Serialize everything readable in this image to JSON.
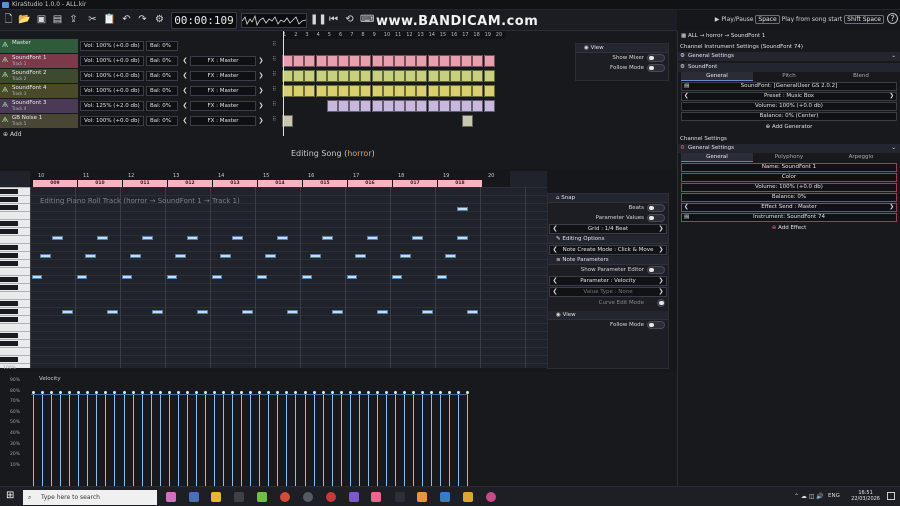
{
  "window": {
    "title": "KiraStudio 1.0.0 - ALL.kir"
  },
  "toolbar": {
    "time": "00:00:109",
    "overlay": "www.BANDICAM.com",
    "hint_play": "Play/Pause",
    "hint_play_key": "Space",
    "hint_start": "Play from song start",
    "hint_start_key": "Shift Space",
    "help": "?"
  },
  "song": {
    "ruler": [
      "1",
      "2",
      "3",
      "4",
      "5",
      "6",
      "7",
      "8",
      "9",
      "10",
      "11",
      "12",
      "13",
      "14",
      "15",
      "16",
      "17",
      "18",
      "19",
      "20"
    ],
    "tracks": [
      {
        "name": "Master",
        "sub": "",
        "vol": "Vol: 100% (+0.0 db)",
        "bal": "Bal: 0%",
        "fx": "",
        "color": "#2e5c3a"
      },
      {
        "name": "SoundFont 1",
        "sub": "Track 1",
        "vol": "Vol: 100% (+0.0 db)",
        "bal": "Bal: 0%",
        "fx": "FX : Master",
        "color": "#7a3a4a"
      },
      {
        "name": "SoundFont 2",
        "sub": "Track 2",
        "vol": "Vol: 100% (+0.0 db)",
        "bal": "Bal: 0%",
        "fx": "FX : Master",
        "color": "#3e4a30"
      },
      {
        "name": "SoundFont 4",
        "sub": "Track 3",
        "vol": "Vol: 100% (+0.0 db)",
        "bal": "Bal: 0%",
        "fx": "FX : Master",
        "color": "#4a4a2a"
      },
      {
        "name": "SoundFont 3",
        "sub": "Track 4",
        "vol": "Vol: 125% (+2.0 db)",
        "bal": "Bal: 0%",
        "fx": "FX : Master",
        "color": "#4a3a55"
      },
      {
        "name": "GB Noise 1",
        "sub": "Track 5",
        "vol": "Vol: 100% (+0.0 db)",
        "bal": "Bal: 0%",
        "fx": "FX : Master",
        "color": "#4a4636"
      }
    ],
    "add_label": "Add",
    "editing_prefix": "Editing Song (",
    "editing_name": "horror",
    "editing_suffix": ")"
  },
  "view_panel": {
    "title": "View",
    "show_mixer": "Show Mixer",
    "follow_mode": "Follow Mode"
  },
  "pianoroll": {
    "ruler": [
      "10",
      "11",
      "12",
      "13",
      "14",
      "15",
      "16",
      "17",
      "18",
      "19",
      "20"
    ],
    "patterns": [
      "009",
      "010",
      "011",
      "012",
      "013",
      "014",
      "015",
      "016",
      "017",
      "018"
    ],
    "editing_label": "Editing Piano Roll Track (horror → SoundFont 1 → Track 1)",
    "zoom": "100%"
  },
  "snap_panel": {
    "snap_title": "Snap",
    "beats": "Beats",
    "param_values": "Parameter Values",
    "grid": "Grid : 1/4 Beat",
    "editing_options": "Editing Options",
    "note_create": "Note Create Mode : Click & Move",
    "note_params": "Note Parameters",
    "show_param_editor": "Show Parameter Editor",
    "parameter": "Parameter : Velocity",
    "value_type": "Value Type : None",
    "curve_edit": "Curve Edit Mode",
    "view": "View",
    "follow_mode": "Follow Mode"
  },
  "velocity": {
    "title": "Velocity",
    "ticks": [
      "90%",
      "80%",
      "70%",
      "60%",
      "50%",
      "40%",
      "30%",
      "20%",
      "10%"
    ],
    "level": 0.8
  },
  "right": {
    "breadcrumb": "ALL → horror → SoundFont 1",
    "channel_instr": "Channel Instrument Settings (SoundFont 74)",
    "general_settings": "General Settings",
    "soundfont": "SoundFont",
    "tabs1": [
      "General",
      "Pitch",
      "Blend"
    ],
    "sf_file": "SoundFont: [GeneralUser GS 2.0.2]",
    "preset": "Preset : Music Box",
    "volume": "Volume: 100% (+0.0 db)",
    "balance": "Balance: 0% (Center)",
    "add_generator": "Add Generator",
    "channel_settings": "Channel Settings",
    "general_settings2": "General Settings",
    "tabs2": [
      "General",
      "Polyphony",
      "Arpeggio"
    ],
    "name": "Name: SoundFont 1",
    "color": "Color",
    "volume2": "Volume: 100% (+0.0 db)",
    "balance2": "Balance: 0%",
    "effect_send": "Effect Send : Master",
    "instrument": "Instrument: SoundFont 74",
    "add_effect": "Add Effect"
  },
  "taskbar": {
    "search": "Type here to search",
    "lang": "ENG",
    "time": "16:51",
    "date": "22/03/2026"
  }
}
